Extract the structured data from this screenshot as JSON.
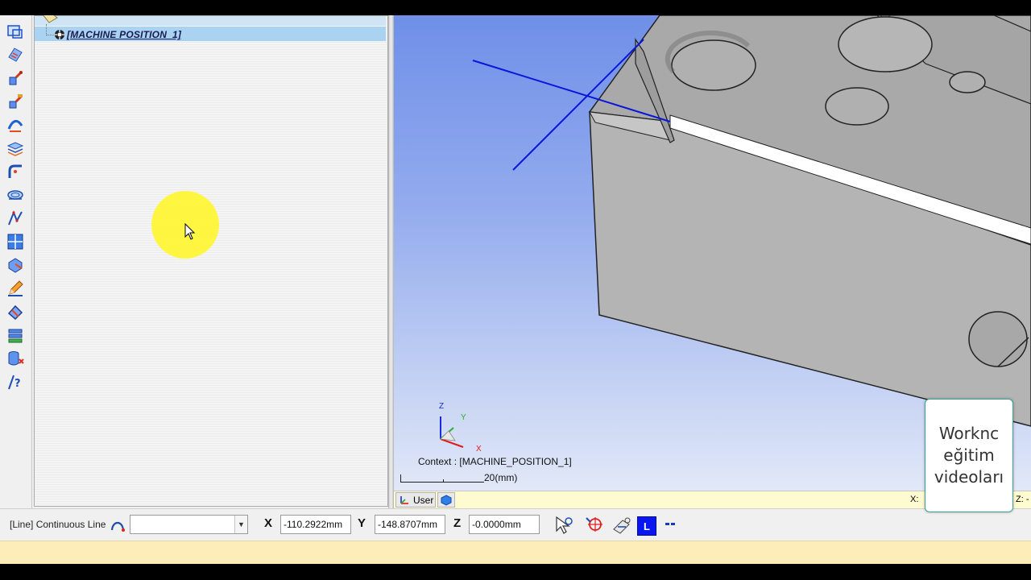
{
  "tree": {
    "selected_item": "[MACHINE POSITION_1]"
  },
  "viewport": {
    "context_label": "Context : [MACHINE_POSITION_1]",
    "scale_label": "20(mm)",
    "axis_x": "X",
    "axis_y": "Y",
    "axis_z": "Z",
    "view_tab_label": "User",
    "status_x_label": "X:",
    "status_z_label": "Z: -"
  },
  "watermark": {
    "text": "Worknc\neğitim\nvideoları"
  },
  "input_bar": {
    "mode_label": "[Line] Continuous Line",
    "combo_value": "",
    "x_label": "X",
    "x_value": "-110.2922mm",
    "y_label": "Y",
    "y_value": "-148.8707mm",
    "z_label": "Z",
    "z_value": "-0.0000mm",
    "lock_button_label": "L"
  },
  "toolbar_icons": [
    "view-frame-icon",
    "surfaces-icon",
    "tool-path-icon",
    "tool-path-2-icon",
    "curves-icon",
    "layers-icon",
    "fillet-icon",
    "lathe-icon",
    "line-tool-icon",
    "grid-view-icon",
    "shape-icon",
    "pencil-icon",
    "eraser-icon",
    "stack-icon",
    "database-icon",
    "help-icon"
  ],
  "colors": {
    "selection_highlight": "#a9d3f0",
    "viewport_top": "#6f8fe8",
    "viewport_bottom": "#e1e8f7",
    "cursor_halo": "#fff538",
    "lock_button": "#0a16f0",
    "message_bar": "#fdedb9"
  }
}
